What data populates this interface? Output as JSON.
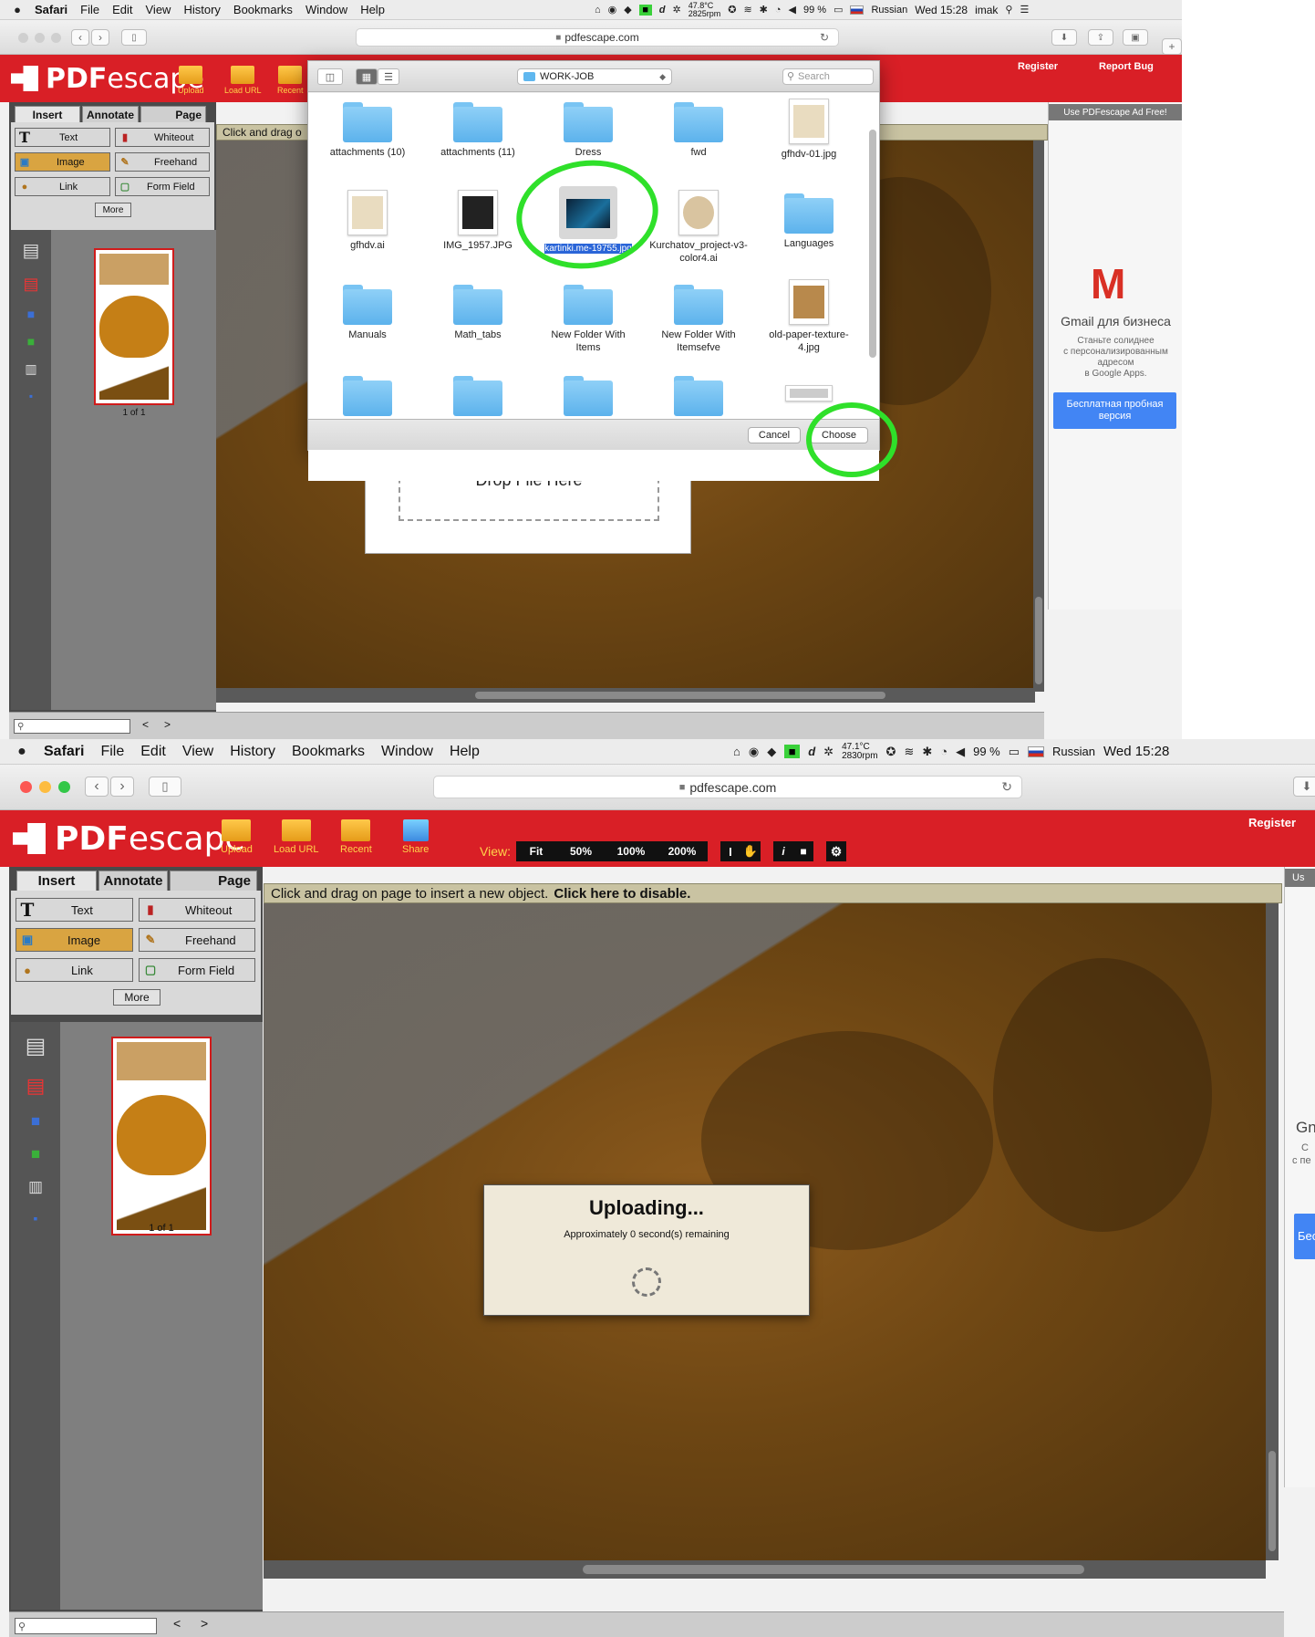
{
  "menubar": {
    "apple": "",
    "app": "Safari",
    "items": [
      "File",
      "Edit",
      "View",
      "History",
      "Bookmarks",
      "Window",
      "Help"
    ],
    "battery": "99 %",
    "language": "Russian",
    "user": "imak"
  },
  "shot1": {
    "temp": "47.8°C",
    "rpm": "2825rpm",
    "clock": "Wed 15:28"
  },
  "shot2": {
    "temp": "47.1°C",
    "rpm": "2830rpm",
    "clock": "Wed 15:28"
  },
  "browser": {
    "url": "pdfescape.com"
  },
  "pdfescape": {
    "logo_pdf": "PDF",
    "logo_escape": "escape",
    "toolbar": [
      "Upload",
      "Load URL",
      "Recent",
      "Share"
    ],
    "register": "Register",
    "report_bug": "Report Bug",
    "view_label": "View:",
    "view_options": [
      "Fit",
      "50%",
      "100%",
      "200%"
    ],
    "tabs": [
      "Insert",
      "Annotate",
      "Page"
    ],
    "tools": [
      "Text",
      "Whiteout",
      "Image",
      "Freehand",
      "Link",
      "Form Field"
    ],
    "more": "More",
    "hint": "Click and drag on page to insert a new object.",
    "hint_bold": "Click here to disable.",
    "hint_short": "Click and drag o",
    "page_label": "1 of 1",
    "pager_prev": "<",
    "pager_next": ">"
  },
  "ad": {
    "header": "Use PDFescape Ad Free!",
    "header_short": "Us",
    "title": "Gmail для бизнеса",
    "title_short": "Gn",
    "lines": [
      "Станьте солиднее",
      "с персонализированным",
      "адресом",
      "в Google Apps."
    ],
    "line_short_1": "С",
    "line_short_2": "с пе",
    "button": "Бесплатная пробная версия",
    "button_short": "Бес"
  },
  "dialog": {
    "folder": "WORK-JOB",
    "search_placeholder": "Search",
    "files": [
      {
        "name": "attachments (10)",
        "kind": "folder"
      },
      {
        "name": "attachments (11)",
        "kind": "folder"
      },
      {
        "name": "Dress",
        "kind": "folder"
      },
      {
        "name": "fwd",
        "kind": "folder"
      },
      {
        "name": "gfhdv-01.jpg",
        "kind": "image"
      },
      {
        "name": "gfhdv.ai",
        "kind": "image"
      },
      {
        "name": "IMG_1957.JPG",
        "kind": "image"
      },
      {
        "name": "kartinki.me-19755.jpg",
        "kind": "selected"
      },
      {
        "name": "Kurchatov_project-v3-color4.ai",
        "kind": "image"
      },
      {
        "name": "Languages",
        "kind": "folder"
      },
      {
        "name": "Manuals",
        "kind": "folder"
      },
      {
        "name": "Math_tabs",
        "kind": "folder"
      },
      {
        "name": "New Folder With Items",
        "kind": "folder"
      },
      {
        "name": "New Folder With Itemsefve",
        "kind": "folder"
      },
      {
        "name": "old-paper-texture-4.jpg",
        "kind": "image"
      }
    ],
    "cancel": "Cancel",
    "choose": "Choose"
  },
  "drop": {
    "label": "Drop File Here"
  },
  "upload": {
    "title": "Uploading...",
    "subtitle": "Approximately 0 second(s) remaining"
  },
  "colors": {
    "pdf_red": "#d91f26",
    "selection_blue": "#2a65d8",
    "annotation_green": "#2fe02a",
    "tool_selected": "#d9a441"
  },
  "icons": [
    "apple-icon",
    "wifi-icon",
    "bluetooth-icon",
    "volume-icon",
    "battery-icon",
    "search-icon",
    "list-icon",
    "lock-icon",
    "reload-icon",
    "folder-icon",
    "cursor-icon",
    "hand-icon",
    "info-icon",
    "gear-icon",
    "spinner-icon"
  ]
}
